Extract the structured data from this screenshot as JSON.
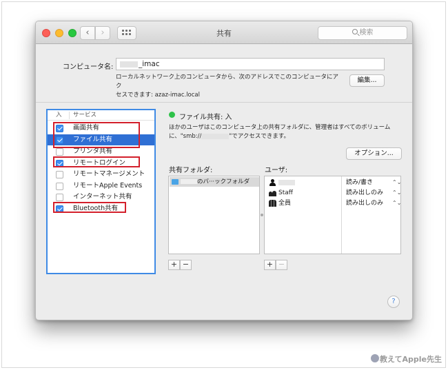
{
  "window": {
    "title": "共有"
  },
  "search": {
    "placeholder": "検索"
  },
  "computer": {
    "label": "コンピュータ名:",
    "name_suffix": "_imac",
    "description_line1": "ローカルネットワーク上のコンピュータから、次のアドレスでこのコンピュータにアク",
    "description_line2": "セスできます: azaz-imac.local",
    "edit_button": "編集..."
  },
  "services": {
    "header_on": "入",
    "header_service": "サービス",
    "items": [
      {
        "label": "画面共有",
        "checked": true,
        "selected": false
      },
      {
        "label": "ファイル共有",
        "checked": true,
        "selected": true
      },
      {
        "label": "プリンタ共有",
        "checked": false,
        "selected": false
      },
      {
        "label": "リモートログイン",
        "checked": true,
        "selected": false
      },
      {
        "label": "リモートマネージメント",
        "checked": false,
        "selected": false
      },
      {
        "label": "リモートApple Events",
        "checked": false,
        "selected": false
      },
      {
        "label": "インターネット共有",
        "checked": false,
        "selected": false
      },
      {
        "label": "Bluetooth共有",
        "checked": true,
        "selected": false
      }
    ]
  },
  "file_sharing": {
    "status": "ファイル共有: 入",
    "desc_line1": "ほかのユーザはこのコンピュータ上の共有フォルダに、管理者はすべてのボリューム",
    "desc_line2_pre": "に、\"smb://",
    "desc_line2_post": "\"でアクセスできます。",
    "options_button": "オプション...",
    "shared_folders_label": "共有フォルダ:",
    "users_label": "ユーザ:",
    "folders": [
      {
        "label": "のバ···ックフォルダ"
      }
    ],
    "users": [
      {
        "name": "",
        "icon": "single-user-icon",
        "permission": "読み/書き"
      },
      {
        "name": "Staff",
        "icon": "group-icon",
        "permission": "読み出しのみ"
      },
      {
        "name": "全員",
        "icon": "everyone-icon",
        "permission": "読み出しのみ"
      }
    ],
    "add_label": "+",
    "remove_label": "−"
  },
  "help": {
    "label": "?"
  },
  "watermark": {
    "text": "教えてApple先生"
  },
  "colors": {
    "selection": "#2f6fd4",
    "checkbox": "#3d8ef2",
    "highlight": "#d31f2b",
    "status_green": "#2fc24a"
  }
}
